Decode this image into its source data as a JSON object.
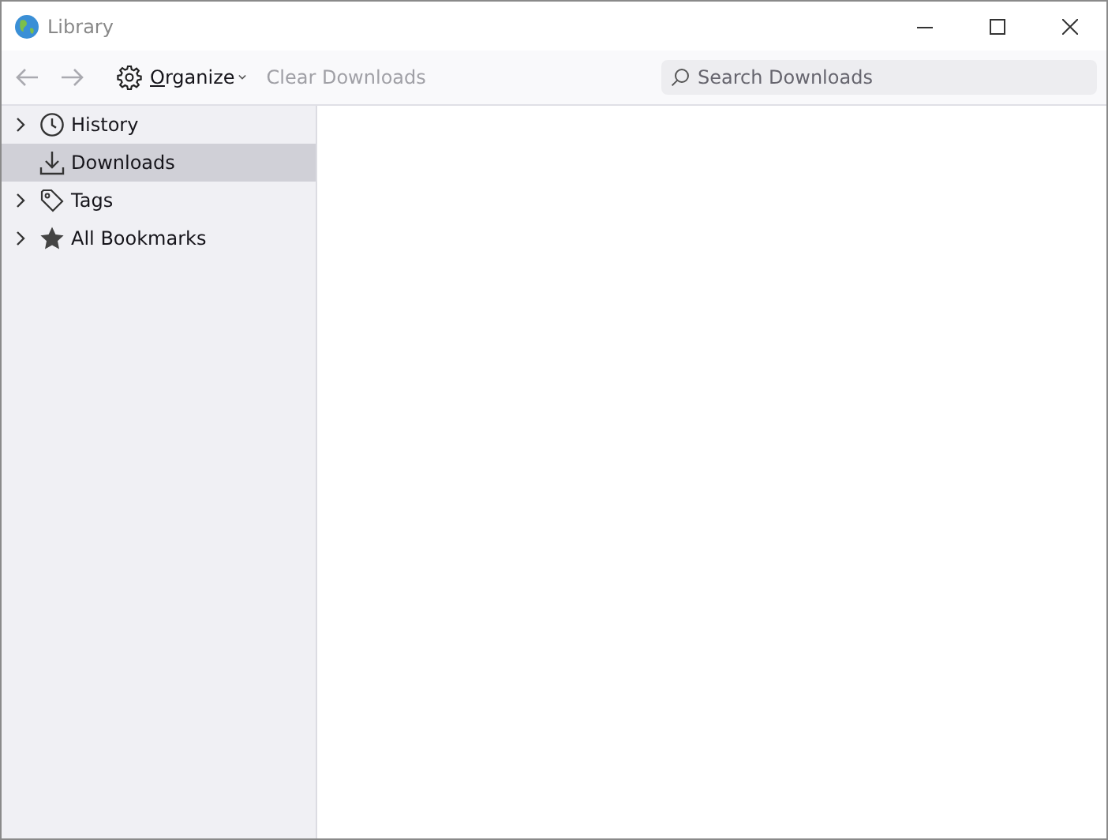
{
  "window": {
    "title": "Library"
  },
  "toolbar": {
    "back": {
      "disabled": true
    },
    "forward": {
      "disabled": true
    },
    "organize": {
      "label": "Organize"
    },
    "clear": {
      "label": "Clear Downloads",
      "disabled": true
    },
    "search": {
      "placeholder": "Search Downloads"
    }
  },
  "sidebar": {
    "items": [
      {
        "label": "History",
        "expanded": false,
        "selected": false
      },
      {
        "label": "Downloads",
        "selected": true
      },
      {
        "label": "Tags",
        "expanded": false,
        "selected": false
      },
      {
        "label": "All Bookmarks",
        "expanded": false,
        "selected": false
      }
    ]
  }
}
